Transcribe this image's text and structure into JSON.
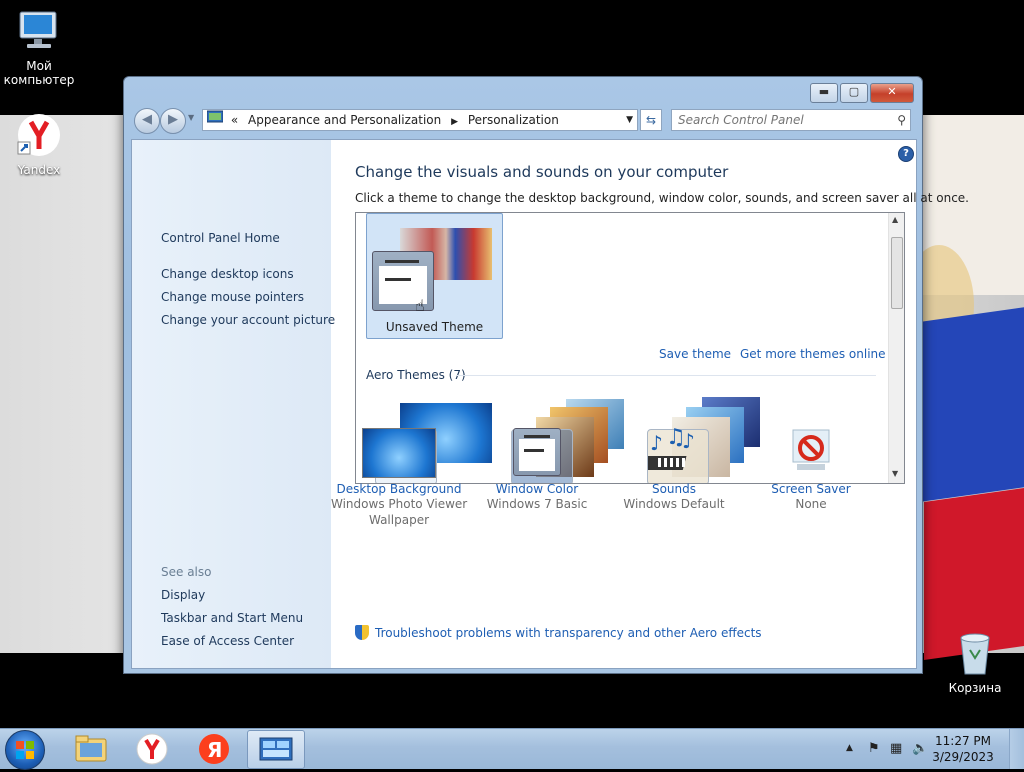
{
  "desktop": {
    "icons": [
      {
        "label": "Мой компьютер"
      },
      {
        "label": "Yandex"
      },
      {
        "label": "Корзина"
      }
    ]
  },
  "window": {
    "address": {
      "chevrons": "«",
      "crumb1": "Appearance and Personalization",
      "crumb2": "Personalization"
    },
    "search_placeholder": "Search Control Panel"
  },
  "sidebar": {
    "home": "Control Panel Home",
    "links": [
      "Change desktop icons",
      "Change mouse pointers",
      "Change your account picture"
    ],
    "see_also": "See also",
    "see_links": [
      "Display",
      "Taskbar and Start Menu",
      "Ease of Access Center"
    ]
  },
  "main": {
    "title": "Change the visuals and sounds on your computer",
    "subtitle": "Click a theme to change the desktop background, window color, sounds, and screen saver all at once.",
    "unsaved_theme": "Unsaved Theme",
    "save_theme": "Save theme",
    "more_themes": "Get more themes online",
    "aero_header": "Aero Themes (7)",
    "options": [
      {
        "title": "Desktop Background",
        "sub": "Windows Photo Viewer",
        "sub2": "Wallpaper"
      },
      {
        "title": "Window Color",
        "sub": "Windows 7 Basic",
        "sub2": ""
      },
      {
        "title": "Sounds",
        "sub": "Windows Default",
        "sub2": ""
      },
      {
        "title": "Screen Saver",
        "sub": "None",
        "sub2": ""
      }
    ],
    "troubleshoot": "Troubleshoot problems with transparency and other Aero effects"
  },
  "taskbar": {
    "time": "11:27 PM",
    "date": "3/29/2023"
  }
}
